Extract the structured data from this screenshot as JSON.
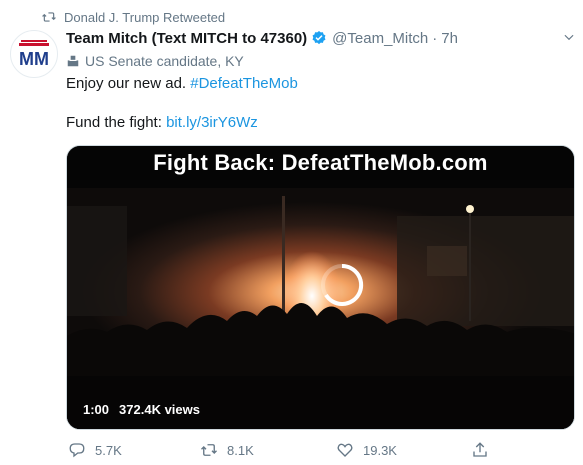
{
  "retweet_context": {
    "icon": "retweet-icon",
    "text": "Donald J. Trump Retweeted"
  },
  "author": {
    "avatar_text": "MM",
    "display_name": "Team Mitch (Text MITCH to 47360)",
    "verified_icon": "verified-badge-icon",
    "handle": "@Team_Mitch",
    "separator": "·",
    "time": "7h",
    "label_icon": "ballot-box-icon",
    "label": "US Senate candidate, KY"
  },
  "tweet": {
    "line1_text": "Enjoy our new ad.",
    "hashtag": "#DefeatTheMob",
    "line2_text": "Fund the fight:",
    "link": "bit.ly/3irY6Wz"
  },
  "video": {
    "title": "Fight Back: DefeatTheMob.com",
    "duration": "1:00",
    "views": "372.4K views"
  },
  "actions": {
    "reply_count": "5.7K",
    "retweet_count": "8.1K",
    "like_count": "19.3K"
  },
  "colors": {
    "link": "#1b95e0",
    "muted": "#657786",
    "verified": "#1da1f2",
    "brand_red": "#c8102e",
    "brand_blue": "#1f3e8c"
  }
}
